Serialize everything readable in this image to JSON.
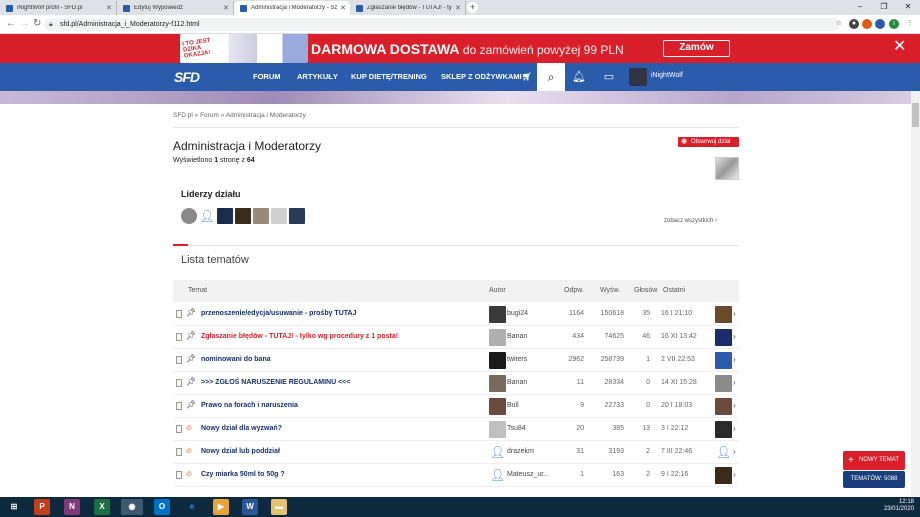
{
  "browser": {
    "tabs": [
      {
        "title": "iNightWolf profil - SFD.pl",
        "color": "#2a5cab"
      },
      {
        "title": "Edytuj Wypowiedź",
        "color": "#2a5cab"
      },
      {
        "title": "Administracja i Moderatorzy - Sz...",
        "color": "#2a5cab",
        "active": true
      },
      {
        "title": "Zgłaszanie błędów - TUTAJ! - tylk...",
        "color": "#2a5cab"
      }
    ],
    "url": "sfd.pl/Administracja_i_Moderatorzy-f112.html"
  },
  "promo": {
    "badge": "I TO JEST DZIKA OKAZJA!",
    "headline": "DARMOWA DOSTAWA",
    "subline": "do zamówień powyżej 99 PLN",
    "button": "Zamów",
    "close": "✕"
  },
  "nav": {
    "logo": "SFD",
    "links": [
      "FORUM",
      "ARTYKUŁY",
      "KUP DIETĘ/TRENING",
      "SKLEP Z ODŻYWKAMI"
    ],
    "username": "iNightWolf",
    "accent": "#2a5cab"
  },
  "page": {
    "breadcrumb": "SFD.pl » Forum » Administracja i Moderatorzy",
    "title": "Administracja i Moderatorzy",
    "info_prefix": "Wyświetlono",
    "info_page": "1",
    "info_mid": "stronę z",
    "info_total": "64",
    "follow_button": "Obserwuj dział",
    "leaders_title": "Liderzy działu",
    "see_all": "zobacz wszystkich",
    "list_title": "Lista tematów"
  },
  "table": {
    "headers": {
      "topic": "Temat",
      "author": "Autor",
      "replies": "Odpw.",
      "views": "Wyśw.",
      "votes": "Głosów",
      "last": "Ostatni"
    },
    "rows": [
      {
        "title": "przenoszenie/edycja/usuwanie - prośby TUTAJ",
        "red": false,
        "pinned": true,
        "author": "bugi24",
        "replies": "1164",
        "views": "150618",
        "votes": "35",
        "last": "16 I 21:10"
      },
      {
        "title": "Zgłaszanie błędów - TUTAJ! - tylko wg procedury z 1 posta!",
        "red": true,
        "pinned": true,
        "author": "Banan",
        "replies": "434",
        "views": "74625",
        "votes": "46",
        "last": "16 XI 13:42"
      },
      {
        "title": "nominowani do bana",
        "red": false,
        "pinned": true,
        "author": "twiters",
        "replies": "2962",
        "views": "258739",
        "votes": "1",
        "last": "2 VII 22:53"
      },
      {
        "title": ">>> ZGŁOŚ NARUSZENIE REGULAMINU <<<",
        "red": false,
        "pinned": true,
        "author": "Banan",
        "replies": "11",
        "views": "28334",
        "votes": "0",
        "last": "14 XI 15:28"
      },
      {
        "title": "Prawo na forach i naruszenia",
        "red": false,
        "pinned": true,
        "author": "Bull",
        "replies": "9",
        "views": "22733",
        "votes": "0",
        "last": "20 I 18:03"
      },
      {
        "title": "Nowy dział dla wyzwań?",
        "red": false,
        "pinned": false,
        "author": "Tsu84",
        "replies": "20",
        "views": "385",
        "votes": "13",
        "last": "3 I 22:12"
      },
      {
        "title": "Nowy dział lub poddział",
        "red": false,
        "pinned": false,
        "author": "drazekm",
        "replies": "31",
        "views": "3193",
        "votes": "2",
        "last": "7 III 22:46"
      },
      {
        "title": "Czy miarka 50ml to 50g ?",
        "red": false,
        "pinned": false,
        "author": "Mateusz_ur...",
        "replies": "1",
        "views": "163",
        "votes": "2",
        "last": "9 I 22:16"
      }
    ]
  },
  "floating": {
    "new_topic": "NOWY TEMAT",
    "topic_count": "TEMATÓW: 5088"
  },
  "taskbar": {
    "time": "12:18",
    "date": "23/01/2020"
  }
}
